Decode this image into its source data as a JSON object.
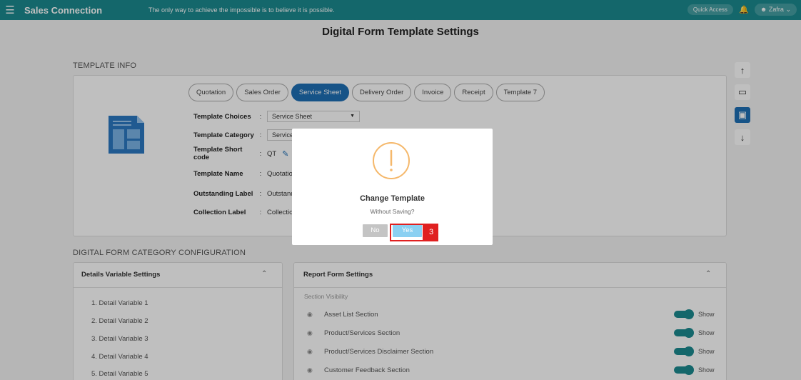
{
  "header": {
    "menu_icon": "hamburger-icon",
    "app_title": "Sales Connection",
    "tagline": "The only way to achieve the impossible is to believe it is possible.",
    "quick_access": "Quick Access",
    "user": "Zafra"
  },
  "page_title": "Digital Form Template Settings",
  "template_info": {
    "section_label": "TEMPLATE INFO",
    "tabs": [
      "Quotation",
      "Sales Order",
      "Service Sheet",
      "Delivery Order",
      "Invoice",
      "Receipt",
      "Template 7"
    ],
    "active_tab": "Service Sheet",
    "fields": {
      "choices_label": "Template Choices",
      "choices_value": "Service Sheet",
      "category_label": "Template Category",
      "category_value": "Service Sh",
      "shortcode_label": "Template Short code",
      "shortcode_value": "QT",
      "name_label": "Template Name",
      "name_value": "Quotation",
      "outstanding_label": "Outstanding Label",
      "outstanding_value": "Outstanding",
      "collection_label": "Collection Label",
      "collection_value": "Collection",
      "sep": ":"
    }
  },
  "side_toolbar": [
    "arrow-up-icon",
    "monitor-icon",
    "save-icon",
    "arrow-down-icon"
  ],
  "category_config": {
    "section_label": "DIGITAL FORM CATEGORY CONFIGURATION",
    "details_title": "Details Variable Settings",
    "details_items": [
      "1.  Detail Variable 1",
      "2.  Detail Variable 2",
      "3.  Detail Variable 3",
      "4.  Detail Variable 4",
      "5.  Detail Variable 5"
    ],
    "report_title": "Report Form Settings",
    "section_visibility": "Section Visibility",
    "report_items": [
      "Asset List Section",
      "Product/Services Section",
      "Product/Services Disclaimer Section",
      "Customer Feedback Section"
    ],
    "toggle_label": "Show"
  },
  "modal": {
    "title": "Change Template",
    "text": "Without Saving?",
    "no": "No",
    "yes": "Yes",
    "step": "3"
  },
  "colors": {
    "topbar": "#1b8a8f",
    "primary": "#1e6fb5",
    "alert": "#f5b86b",
    "highlight": "#e02020"
  }
}
